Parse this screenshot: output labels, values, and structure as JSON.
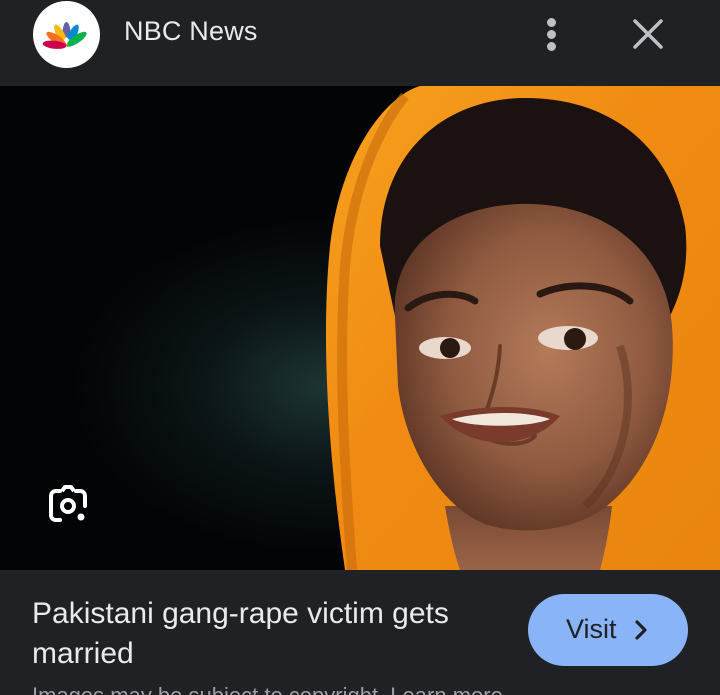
{
  "header": {
    "source_name": "NBC News",
    "logo_icon": "nbc-peacock-icon",
    "more_icon": "more-vertical-icon",
    "close_icon": "close-icon"
  },
  "image": {
    "lens_icon": "google-lens-icon"
  },
  "article": {
    "headline": "Pakistani gang-rape victim gets married",
    "visit_label": "Visit",
    "visit_icon": "chevron-right-icon",
    "disclaimer": "Images may be subject to copyright.",
    "learn_more": "Learn more"
  },
  "colors": {
    "background": "#202124",
    "text": "#e8eaed",
    "accent": "#8ab4f8",
    "icon": "#bdc1c6"
  }
}
